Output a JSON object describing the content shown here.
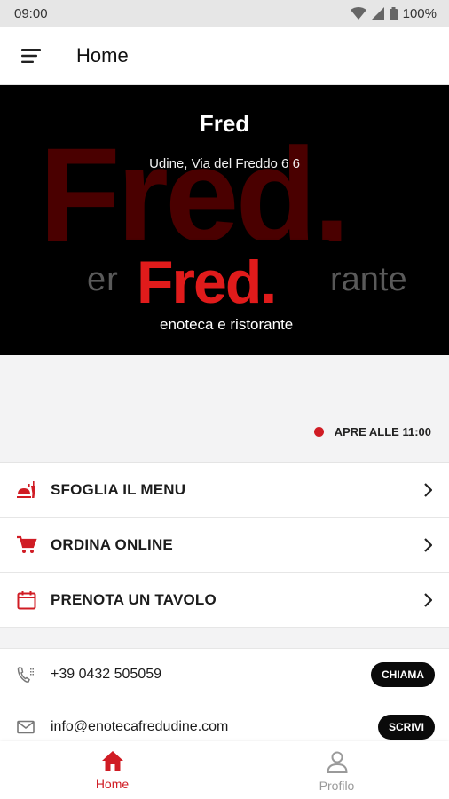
{
  "status_bar": {
    "time": "09:00",
    "battery": "100%"
  },
  "app_bar": {
    "title": "Home",
    "menu_icon": "hamburger-icon"
  },
  "hero": {
    "title": "Fred",
    "address": "Udine, Via del Freddo 6 6",
    "bg_word": "Fred.",
    "bg_sub_left": "er",
    "bg_sub_right": "rante",
    "logo_word": "Fred.",
    "logo_sub": "enoteca e ristorante",
    "photo_count": "1"
  },
  "open_status": {
    "text": "APRE ALLE 11:00",
    "color": "#d01c24"
  },
  "menu_items": [
    {
      "label": "SFOGLIA IL MENU",
      "icon": "menu-food-icon"
    },
    {
      "label": "ORDINA ONLINE",
      "icon": "cart-icon"
    },
    {
      "label": "PRENOTA UN TAVOLO",
      "icon": "calendar-icon"
    }
  ],
  "contacts": {
    "phone": {
      "value": "+39 0432 505059",
      "action": "CHIAMA"
    },
    "email": {
      "value": "info@enotecafredudine.com",
      "action": "SCRIVI"
    }
  },
  "bottom_nav": {
    "home_label": "Home",
    "profile_label": "Profilo"
  },
  "colors": {
    "accent": "#d01c24",
    "dark": "#0a0a0a"
  }
}
